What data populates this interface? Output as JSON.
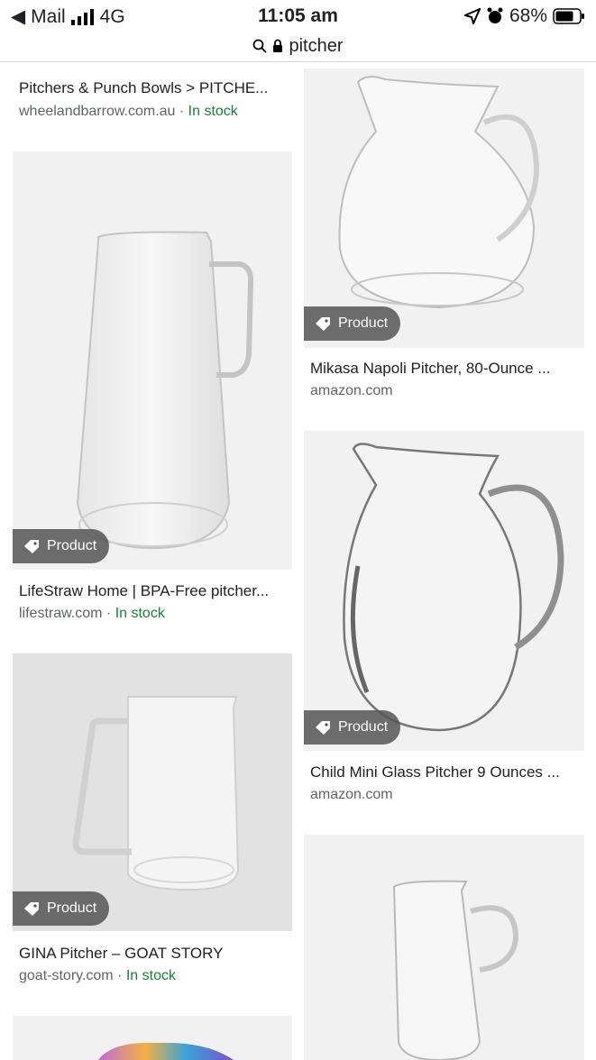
{
  "status_bar": {
    "back_app": "Mail",
    "network": "4G",
    "time": "11:05 am",
    "battery": "68%"
  },
  "url_bar": {
    "query": "pitcher"
  },
  "results": [
    {
      "title": "Pitchers & Punch Bowls > PITCHE...",
      "source": "wheelandbarrow.com.au",
      "stock": "In stock"
    },
    {
      "title": "LifeStraw Home | BPA-Free pitcher...",
      "source": "lifestraw.com",
      "stock": "In stock",
      "badge": "Product"
    },
    {
      "title": "GINA Pitcher – GOAT STORY",
      "source": "goat-story.com",
      "stock": "In stock",
      "badge": "Product"
    },
    {
      "title": "Mikasa Napoli Pitcher, 80-Ounce ...",
      "source": "amazon.com",
      "badge": "Product"
    },
    {
      "title": "Child Mini Glass Pitcher 9 Ounces ...",
      "source": "amazon.com",
      "badge": "Product"
    }
  ],
  "separator": " · "
}
